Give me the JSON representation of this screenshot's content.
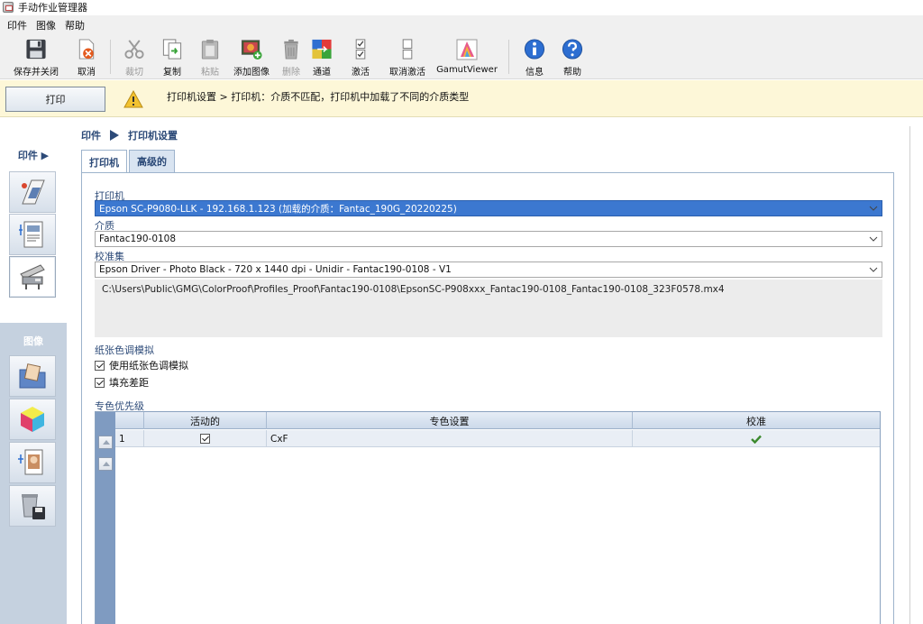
{
  "window": {
    "title": "手动作业管理器"
  },
  "menu": [
    "印件",
    "图像",
    "帮助"
  ],
  "toolbar": {
    "save_close": "保存并关闭",
    "cancel": "取消",
    "cut": "裁切",
    "copy": "复制",
    "paste": "粘贴",
    "add_image": "添加图像",
    "delete": "删除",
    "channels": "通道",
    "activate": "激活",
    "deactivate": "取消激活",
    "gamut_viewer": "GamutViewer",
    "info": "信息",
    "help": "帮助"
  },
  "alert": {
    "print_button": "打印",
    "message": "打印机设置 > 打印机：介质不匹配，打印机中加载了不同的介质类型"
  },
  "leftnav": {
    "print_section": "印件",
    "image_section": "图像"
  },
  "breadcrumb": {
    "root": "印件",
    "current": "打印机设置"
  },
  "tabs": {
    "printer": "打印机",
    "advanced": "高级的"
  },
  "form": {
    "printer_label": "打印机",
    "printer_value": "Epson SC-P9080-LLK - 192.168.1.123 (加载的介质：Fantac_190G_20220225)",
    "media_label": "介质",
    "media_value": "Fantac190-0108",
    "calibration_label": "校准集",
    "calibration_value": "Epson Driver - Photo Black - 720 x 1440 dpi - Unidir - Fantac190-0108 - V1",
    "profile_path": "C:\\Users\\Public\\GMG\\ColorProof\\Profiles_Proof\\Fantac190-0108\\EpsonSC-P908xxx_Fantac190-0108_Fantac190-0108_323F0578.mx4",
    "paper_tone_label": "纸张色调模拟",
    "use_paper_tone": "使用纸张色调模拟",
    "fill_margin": "填充差距",
    "spot_priority_label": "专色优先级"
  },
  "grid": {
    "headers": {
      "active": "活动的",
      "spot_settings": "专色设置",
      "calibration": "校准"
    },
    "rows": [
      {
        "index": "1",
        "spot": "CxF"
      }
    ]
  },
  "colors": {
    "accent": "#2c4a78",
    "selection": "#3c78d0",
    "alert_bg": "#fdf7d8",
    "nav_bg": "#c5d1df"
  }
}
